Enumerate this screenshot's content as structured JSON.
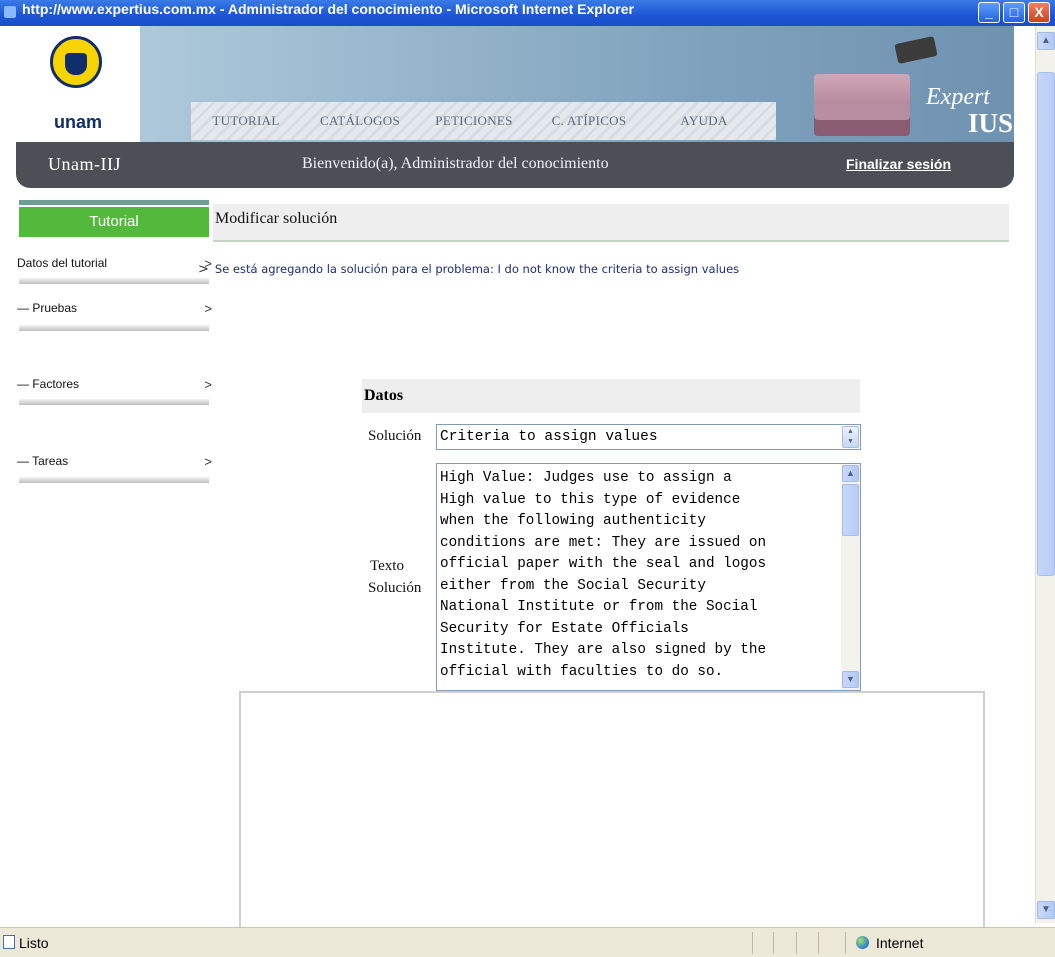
{
  "window": {
    "title": "http://www.expertius.com.mx - Administrador del conocimiento - Microsoft Internet Explorer",
    "minimize": "_",
    "maximize": "□",
    "close": "X"
  },
  "header": {
    "logo_text": "unam",
    "nav": [
      "TUTORIAL",
      "CATÁLOGOS",
      "PETICIONES",
      "C. ATÍPICOS",
      "AYUDA"
    ],
    "brand_expert": "Expert",
    "brand_ius": "IUS",
    "site_name": "Unam-IIJ",
    "welcome": "Bienvenido(a), Administrador del conocimiento",
    "logout": "Finalizar sesión"
  },
  "sidebar": {
    "header": "Tutorial",
    "items": [
      {
        "label": "Datos del tutorial",
        "chevron": ">"
      },
      {
        "label": "— Pruebas",
        "chevron": ">"
      },
      {
        "label": "— Factores",
        "chevron": ">"
      },
      {
        "label": "— Tareas",
        "chevron": ">"
      }
    ]
  },
  "main": {
    "section_title": "Modificar solución",
    "notice_arrow": ">",
    "notice": "Se está agregando la solución para el problema: I do not know the criteria to assign values",
    "form_title": "Datos",
    "solucion_label": "Solución",
    "solucion_value": "Criteria to assign values",
    "texto_label_1": "Texto",
    "texto_label_2": "Solución",
    "texto_value": "High Value: Judges use to assign a\nHigh value to this type of evidence\nwhen the following authenticity\nconditions are met: They are issued on\nofficial paper with the seal and logos\neither from the Social Security\nNational Institute or from the Social\nSecurity for Estate Officials\nInstitute. They are also signed by the\nofficial with faculties to do so."
  },
  "statusbar": {
    "status": "Listo",
    "zone": "Internet"
  }
}
